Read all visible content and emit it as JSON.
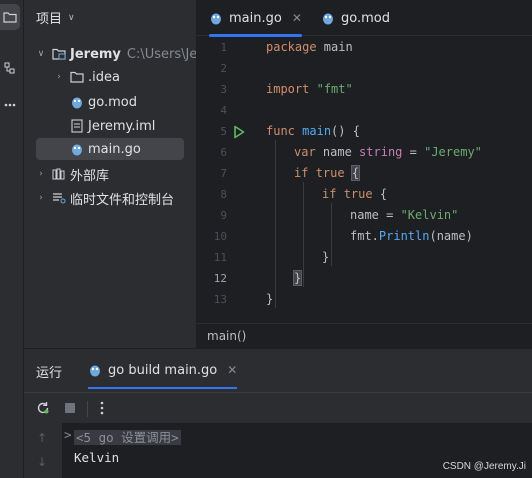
{
  "project_panel": {
    "title": "项目",
    "tree": [
      {
        "label": "Jeremy",
        "hint": "C:\\Users\\Jer",
        "icon": "folder-icon"
      },
      {
        "label": ".idea",
        "icon": "folder-icon"
      },
      {
        "label": "go.mod",
        "icon": "go-module-icon"
      },
      {
        "label": "Jeremy.iml",
        "icon": "file-icon"
      },
      {
        "label": "main.go",
        "icon": "go-file-icon"
      },
      {
        "label": "外部库",
        "icon": "library-icon"
      },
      {
        "label": "临时文件和控制台",
        "icon": "scratches-icon"
      }
    ]
  },
  "editor": {
    "tabs": [
      {
        "label": "main.go",
        "active": true
      },
      {
        "label": "go.mod",
        "active": false
      }
    ],
    "line_numbers": [
      "1",
      "2",
      "3",
      "4",
      "5",
      "6",
      "7",
      "8",
      "9",
      "10",
      "11",
      "12",
      "13"
    ],
    "current_line": "12",
    "code": {
      "l1_kw": "package",
      "l1_rest": " main",
      "l3_kw": "import",
      "l3_str": "\"fmt\"",
      "l5_kw": "func",
      "l5_fn": "main",
      "l5_rest": "() {",
      "l6_kw": "var",
      "l6_name": " name ",
      "l6_type": "string",
      "l6_eq": " = ",
      "l6_str": "\"Jeremy\"",
      "l7_kw": "if",
      "l7_kw2": "true",
      "l7_brace": "{",
      "l8_kw": "if",
      "l8_kw2": "true",
      "l8_brace": " {",
      "l9_name": "name = ",
      "l9_str": "\"Kelvin\"",
      "l10_pkg": "fmt.",
      "l10_fn": "Println",
      "l10_rest": "(name)",
      "l11": "}",
      "l12": "}",
      "l13": "}"
    },
    "breadcrumb": "main()"
  },
  "run_panel": {
    "title": "运行",
    "tab_label": "go build main.go",
    "console": {
      "prompt_glyph": ">",
      "command": "<5 go 设置调用>",
      "output": "Kelvin"
    }
  },
  "watermark": "CSDN @Jeremy.Ji",
  "colors": {
    "accent": "#3574f0",
    "run_icon": "#5fb865",
    "go_icon": "#6fa8dc"
  }
}
